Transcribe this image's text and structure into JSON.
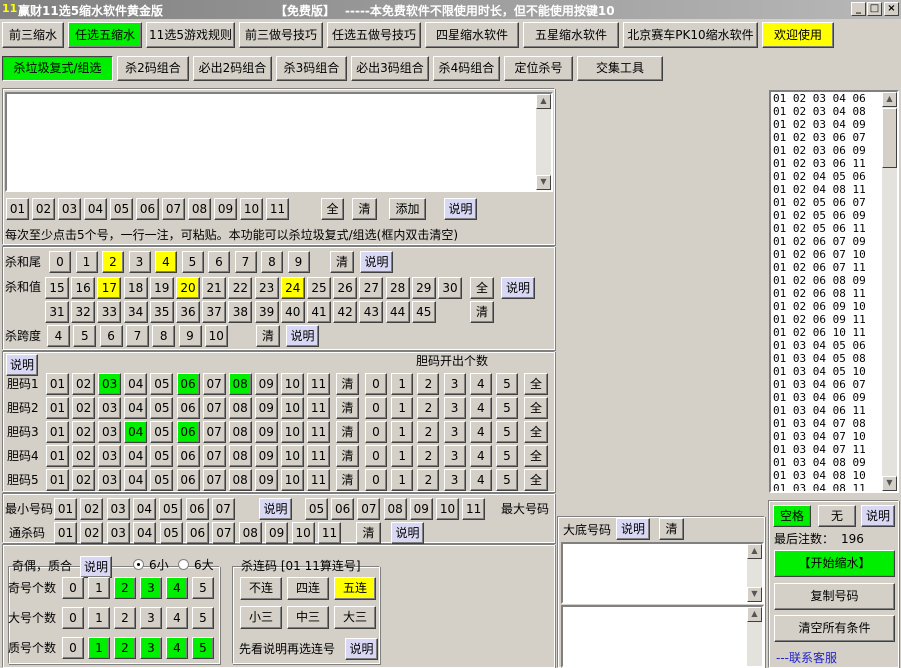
{
  "window": {
    "app_name": "赢财11选5缩水软件黄金版",
    "edition": "【免费版】",
    "notice": "-----本免费软件不限使用时长，但不能使用按键10",
    "icon_text": "11"
  },
  "main_tabs": [
    "前三缩水",
    "任选五缩水",
    "11选5游戏规则",
    "前三做号技巧",
    "任选五做号技巧",
    "四星缩水软件",
    "五星缩水软件",
    "北京赛车PK10缩水软件",
    "欢迎使用"
  ],
  "sub_tabs": [
    "杀垃圾复式/组选",
    "杀2码组合",
    "必出2码组合",
    "杀3码组合",
    "必出3码组合",
    "杀4码组合",
    "定位杀号",
    "交集工具"
  ],
  "common": {
    "clear": "清",
    "all": "全",
    "explain": "说明",
    "add": "添加"
  },
  "numbers": [
    "01",
    "02",
    "03",
    "04",
    "05",
    "06",
    "07",
    "08",
    "09",
    "10",
    "11"
  ],
  "input_hint": "每次至少点击5个号，一行一注，可粘贴。本功能可以杀垃圾复式/组选(框内双击清空)",
  "kill_tail": {
    "label": "杀和尾",
    "values": [
      "0",
      "1",
      "2",
      "3",
      "4",
      "5",
      "6",
      "7",
      "8",
      "9"
    ],
    "highlight": [
      "2",
      "4"
    ]
  },
  "kill_sum": {
    "label": "杀和值",
    "row1": [
      "15",
      "16",
      "17",
      "18",
      "19",
      "20",
      "21",
      "22",
      "23",
      "24",
      "25",
      "26",
      "27",
      "28",
      "29",
      "30"
    ],
    "row2": [
      "31",
      "32",
      "33",
      "34",
      "35",
      "36",
      "37",
      "38",
      "39",
      "40",
      "41",
      "42",
      "43",
      "44",
      "45"
    ],
    "highlight": [
      "17",
      "20",
      "24"
    ]
  },
  "kill_span": {
    "label": "杀跨度",
    "values": [
      "4",
      "5",
      "6",
      "7",
      "8",
      "9",
      "10"
    ]
  },
  "dan": {
    "title": "胆码开出个数",
    "counts": [
      "0",
      "1",
      "2",
      "3",
      "4",
      "5"
    ],
    "rows": [
      {
        "label": "胆码1",
        "green": [
          "03",
          "06",
          "08"
        ]
      },
      {
        "label": "胆码2",
        "green": []
      },
      {
        "label": "胆码3",
        "green": [
          "04",
          "06"
        ]
      },
      {
        "label": "胆码4",
        "green": []
      },
      {
        "label": "胆码5",
        "green": []
      }
    ]
  },
  "min_code": {
    "label": "最小号码",
    "values": [
      "01",
      "02",
      "03",
      "04",
      "05",
      "06",
      "07"
    ]
  },
  "max_code": {
    "label": "最大号码",
    "values": [
      "05",
      "06",
      "07",
      "08",
      "09",
      "10",
      "11"
    ]
  },
  "tong_sha": {
    "label": "通杀码"
  },
  "parity": {
    "title": "奇偶，质合",
    "radio_small": "6小",
    "radio_big": "6大",
    "counts": [
      "0",
      "1",
      "2",
      "3",
      "4",
      "5"
    ],
    "rows": [
      {
        "label": "奇号个数",
        "green": [
          "2",
          "3",
          "4"
        ]
      },
      {
        "label": "大号个数",
        "green": []
      },
      {
        "label": "质号个数",
        "green": [
          "1",
          "2",
          "3",
          "4",
          "5"
        ]
      }
    ]
  },
  "consecutive": {
    "title": "杀连码 [01 11算连号]",
    "buttons": [
      [
        "不连",
        "四连",
        "五连"
      ],
      [
        "小三",
        "中三",
        "大三"
      ]
    ],
    "highlight": "五连",
    "hint": "先看说明再选连号"
  },
  "big_base": {
    "label": "大底号码"
  },
  "right_panel": {
    "space": "空格",
    "none": "无",
    "final_label": "最后注数：",
    "final_count": "196",
    "start": "【开始缩水】",
    "copy": "复制号码",
    "clear_all": "清空所有条件",
    "contact": "---联系客服"
  },
  "results": [
    "01 02 03 04 06",
    "01 02 03 04 08",
    "01 02 03 04 09",
    "01 02 03 06 07",
    "01 02 03 06 09",
    "01 02 03 06 11",
    "01 02 04 05 06",
    "01 02 04 08 11",
    "01 02 05 06 07",
    "01 02 05 06 09",
    "01 02 05 06 11",
    "01 02 06 07 09",
    "01 02 06 07 10",
    "01 02 06 07 11",
    "01 02 06 08 09",
    "01 02 06 08 11",
    "01 02 06 09 10",
    "01 02 06 09 11",
    "01 02 06 10 11",
    "01 03 04 05 06",
    "01 03 04 05 08",
    "01 03 04 05 10",
    "01 03 04 06 07",
    "01 03 04 06 09",
    "01 03 04 06 11",
    "01 03 04 07 08",
    "01 03 04 07 10",
    "01 03 04 07 11",
    "01 03 04 08 09",
    "01 03 04 08 10",
    "01 03 04 08 11"
  ]
}
